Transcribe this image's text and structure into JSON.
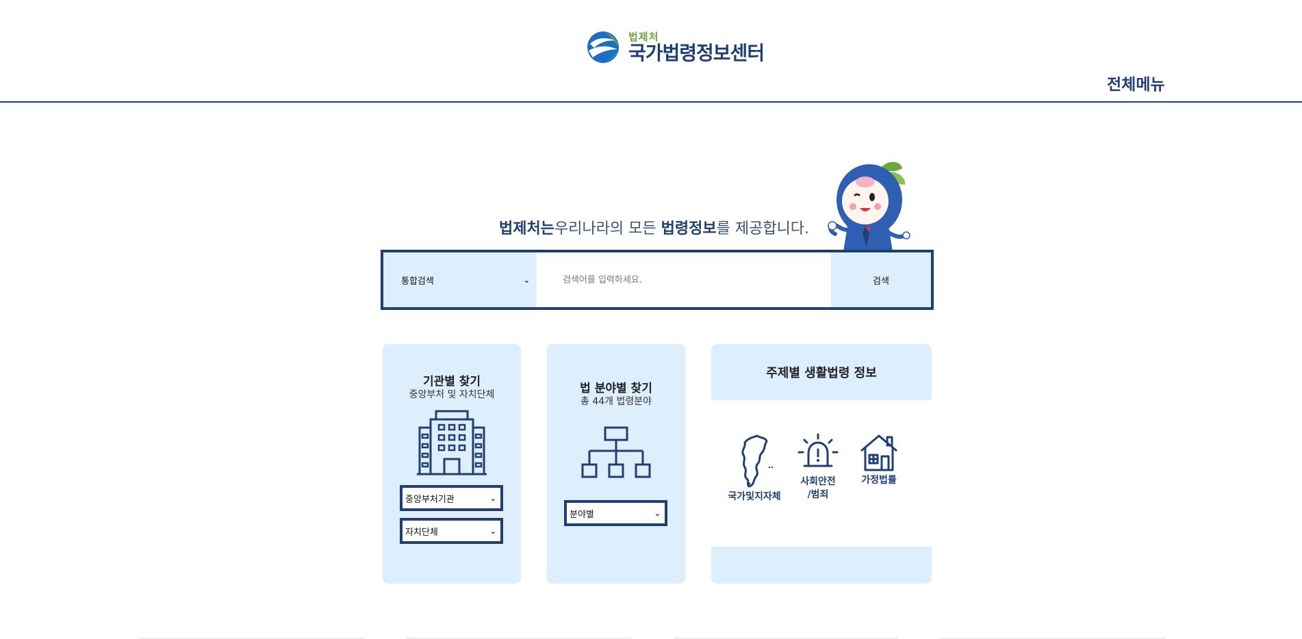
{
  "header": {
    "logo_sub": "법제처",
    "logo_main": "국가법령정보센터",
    "all_menu": "전체메뉴"
  },
  "tagline": {
    "part1": "법제처는",
    "part2": "우리나라의 모든 ",
    "part3": "법령정보",
    "part4": "를 제공합니다."
  },
  "search": {
    "scope_selected": "통합검색",
    "placeholder": "검색어를 입력하세요.",
    "button": "검색"
  },
  "cards": {
    "org": {
      "title": "기관별 찾기",
      "subtitle": "중앙부처 및 자치단체",
      "select1": "중앙부처기관",
      "select2": "자치단체"
    },
    "field": {
      "title": "법 분야별 찾기",
      "subtitle": "총 44개 법령분야",
      "select": "분야별"
    },
    "topic": {
      "title": "주제별 생활법령 정보",
      "items": [
        {
          "label": "국가및지자체",
          "icon": "korea-map-icon"
        },
        {
          "label": "사회안전\n/범죄",
          "icon": "alarm-siren-icon"
        },
        {
          "label": "가정법률",
          "icon": "house-icon"
        }
      ]
    }
  },
  "colors": {
    "primary": "#1f3f73",
    "light_panel": "#ddeefc",
    "logo_green": "#6aa83a"
  }
}
